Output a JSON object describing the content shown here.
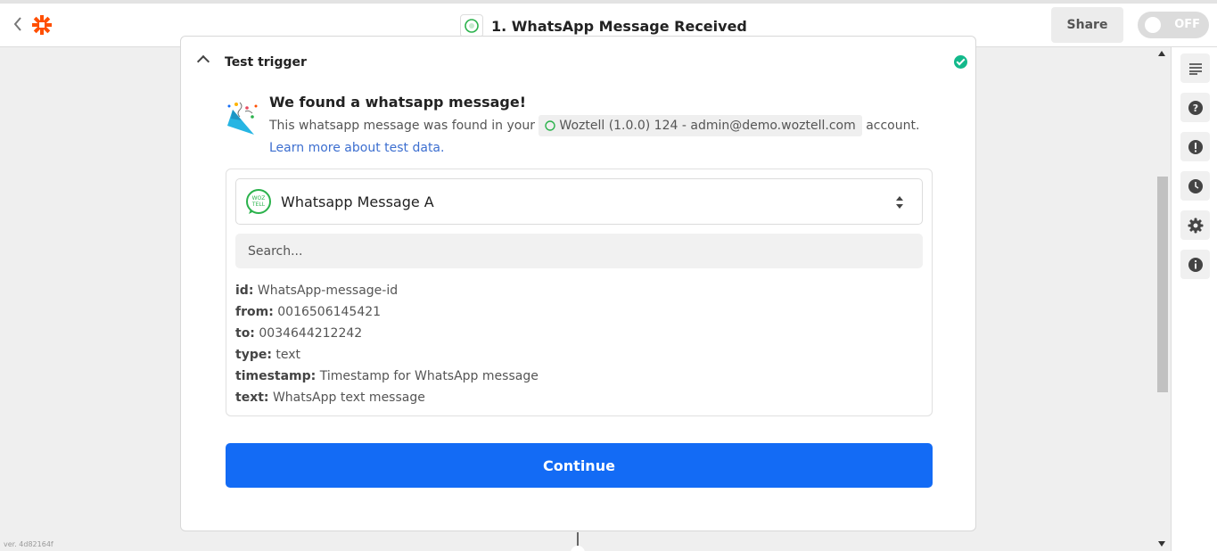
{
  "header": {
    "title": "1. WhatsApp Message Received",
    "share_label": "Share",
    "toggle_label": "OFF",
    "brand_color": "#ff4f00"
  },
  "section": {
    "title": "Test trigger",
    "status_icon": "check-circle-icon"
  },
  "result": {
    "heading": "We found a whatsapp message!",
    "text_before": "This whatsapp message was found in your",
    "account_label": "Woztell (1.0.0) 124 - admin@demo.woztell.com",
    "text_after": "account.",
    "link_text": "Learn more about test data."
  },
  "selector": {
    "selected": "Whatsapp Message A"
  },
  "search": {
    "placeholder": "Search..."
  },
  "fields": [
    {
      "key": "id:",
      "value": "WhatsApp-message-id"
    },
    {
      "key": "from:",
      "value": "0016506145421"
    },
    {
      "key": "to:",
      "value": "0034644212242"
    },
    {
      "key": "type:",
      "value": "text"
    },
    {
      "key": "timestamp:",
      "value": "Timestamp for WhatsApp message"
    },
    {
      "key": "text:",
      "value": "WhatsApp text message"
    }
  ],
  "continue_label": "Continue",
  "version_text": "ver. 4d82164f",
  "sidebar": [
    "outline-icon",
    "help-icon",
    "alert-icon",
    "history-icon",
    "settings-icon",
    "info-icon"
  ],
  "accent_color": "#136bf5"
}
